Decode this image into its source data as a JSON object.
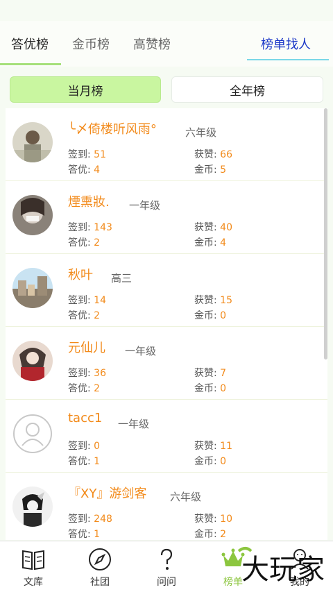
{
  "tabs": [
    {
      "label": "答优榜"
    },
    {
      "label": "金币榜"
    },
    {
      "label": "高赞榜"
    }
  ],
  "find_label": "榜单找人",
  "segments": {
    "month": "当月榜",
    "year": "全年榜"
  },
  "stat_labels": {
    "checkin": "签到:",
    "likes": "获赞:",
    "answers": "答优:",
    "coins": "金币:"
  },
  "users": [
    {
      "name": "╰〆倚楼听风雨°",
      "grade": "六年级",
      "checkin": "51",
      "likes": "66",
      "answers": "4",
      "coins": "5"
    },
    {
      "name": "煙熏妝.",
      "grade": "一年级",
      "checkin": "143",
      "likes": "40",
      "answers": "2",
      "coins": "4"
    },
    {
      "name": "秋叶",
      "grade": "高三",
      "checkin": "14",
      "likes": "15",
      "answers": "2",
      "coins": "0"
    },
    {
      "name": "元仙儿",
      "grade": "一年级",
      "checkin": "36",
      "likes": "7",
      "answers": "2",
      "coins": "0"
    },
    {
      "name": "tacc1",
      "grade": "一年级",
      "checkin": "0",
      "likes": "11",
      "answers": "1",
      "coins": "0"
    },
    {
      "name": "『XY』游剑客",
      "grade": "六年级",
      "checkin": "248",
      "likes": "10",
      "answers": "1",
      "coins": "2"
    }
  ],
  "bottom_nav": [
    {
      "label": "文库",
      "icon": "book-icon"
    },
    {
      "label": "社团",
      "icon": "compass-icon"
    },
    {
      "label": "问问",
      "icon": "question-icon"
    },
    {
      "label": "榜单",
      "icon": "crown-icon"
    },
    {
      "label": "我的",
      "icon": "user-icon"
    }
  ],
  "watermark": "大玩家",
  "colors": {
    "accent_green": "#a6e07a",
    "name_orange": "#f28a1a",
    "link_blue": "#1a36c7"
  }
}
